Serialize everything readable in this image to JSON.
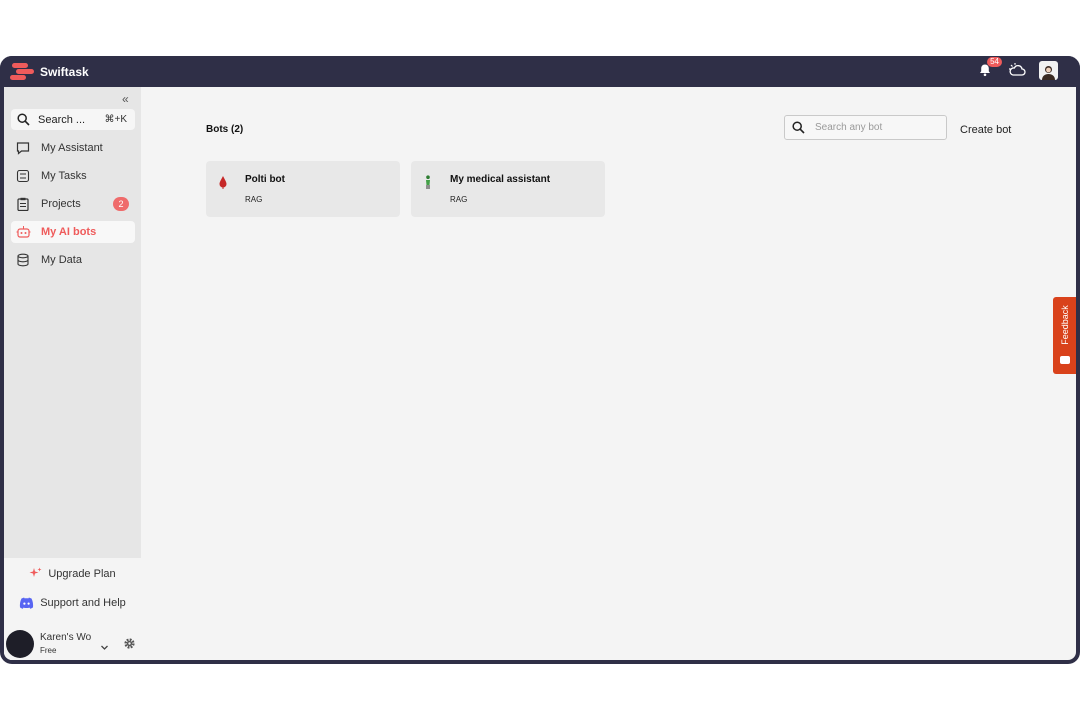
{
  "app": {
    "title": "Swiftask",
    "notification_count": "54",
    "brand_color": "#ef5b5b",
    "topbar_color": "#2f2f47"
  },
  "sidebar": {
    "search_label": "Search ...",
    "search_shortcut": "⌘+K",
    "items": [
      {
        "label": "My Assistant",
        "icon": "chat-bubble-icon"
      },
      {
        "label": "My Tasks",
        "icon": "tasks-icon"
      },
      {
        "label": "Projects",
        "icon": "clipboard-icon",
        "badge": "2"
      },
      {
        "label": "My AI bots",
        "icon": "robot-icon",
        "active": true
      },
      {
        "label": "My Data",
        "icon": "database-icon"
      }
    ],
    "upgrade_label": "Upgrade Plan",
    "support_label": "Support and Help",
    "user": {
      "name": "Karen's Wo",
      "plan": "Free"
    }
  },
  "main": {
    "title": "Bots (2)",
    "search_placeholder": "Search any bot",
    "create_label": "Create bot",
    "bots": [
      {
        "name": "Polti bot",
        "type": "RAG",
        "icon": "drop-icon"
      },
      {
        "name": "My medical assistant",
        "type": "RAG",
        "icon": "figure-icon"
      }
    ]
  },
  "feedback": {
    "label": "Feedback",
    "color": "#d9421b"
  }
}
